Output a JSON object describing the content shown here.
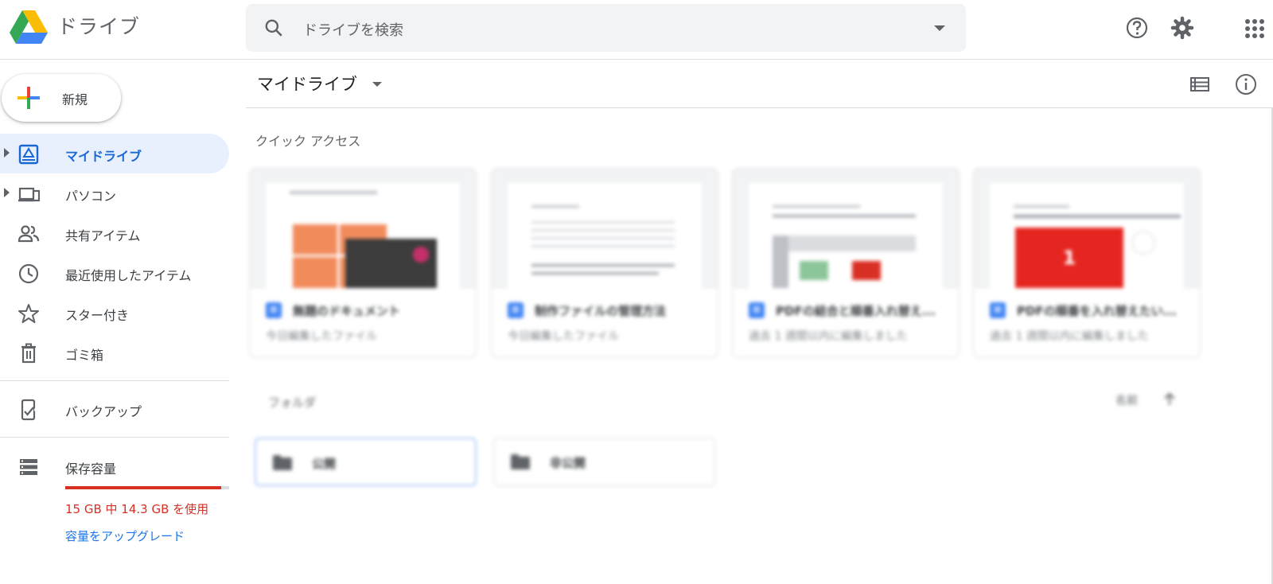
{
  "header": {
    "app_name": "ドライブ",
    "search_placeholder": "ドライブを検索",
    "icons": [
      "help-icon",
      "settings-icon",
      "apps-grid-icon"
    ]
  },
  "sidebar": {
    "new_label": "新規",
    "items": [
      {
        "label": "マイドライブ",
        "icon": "my-drive-icon",
        "active": true,
        "expandable": true
      },
      {
        "label": "パソコン",
        "icon": "computers-icon",
        "expandable": true
      },
      {
        "label": "共有アイテム",
        "icon": "shared-people-icon"
      },
      {
        "label": "最近使用したアイテム",
        "icon": "clock-icon"
      },
      {
        "label": "スター付き",
        "icon": "star-icon"
      },
      {
        "label": "ゴミ箱",
        "icon": "trash-icon"
      },
      {
        "label": "バックアップ",
        "icon": "backup-icon"
      },
      {
        "label": "保存容量",
        "icon": "storage-icon"
      }
    ],
    "storage": {
      "usage_text": "15 GB 中 14.3 GB を使用",
      "used_fraction": 0.953,
      "upgrade_label": "容量をアップグレード",
      "bar_color": "#d93025"
    }
  },
  "main": {
    "title": "マイドライブ",
    "quick_access_label": "クイック アクセス",
    "cards": [
      {
        "name": "無題のドキュメント",
        "subtitle": "今日編集したファイル"
      },
      {
        "name": "制作ファイルの管理方法",
        "subtitle": "今日編集したファイル"
      },
      {
        "name": "PDFの結合と順番入れ替え...",
        "subtitle": "過去 1 週間以内に編集しました"
      },
      {
        "name": "PDFの順番を入れ替えたい...",
        "subtitle": "過去 1 週間以内に編集しました"
      }
    ],
    "thumbnail_badge": "1",
    "folders_label": "フォルダ",
    "sort_label": "名前",
    "folders": [
      {
        "name": "公開",
        "selected": true
      },
      {
        "name": "非公開",
        "selected": false
      }
    ]
  },
  "colors": {
    "active_bg": "#e8f0fe",
    "active_text": "#1967d2",
    "link": "#1a73e8",
    "warning": "#d93025"
  }
}
